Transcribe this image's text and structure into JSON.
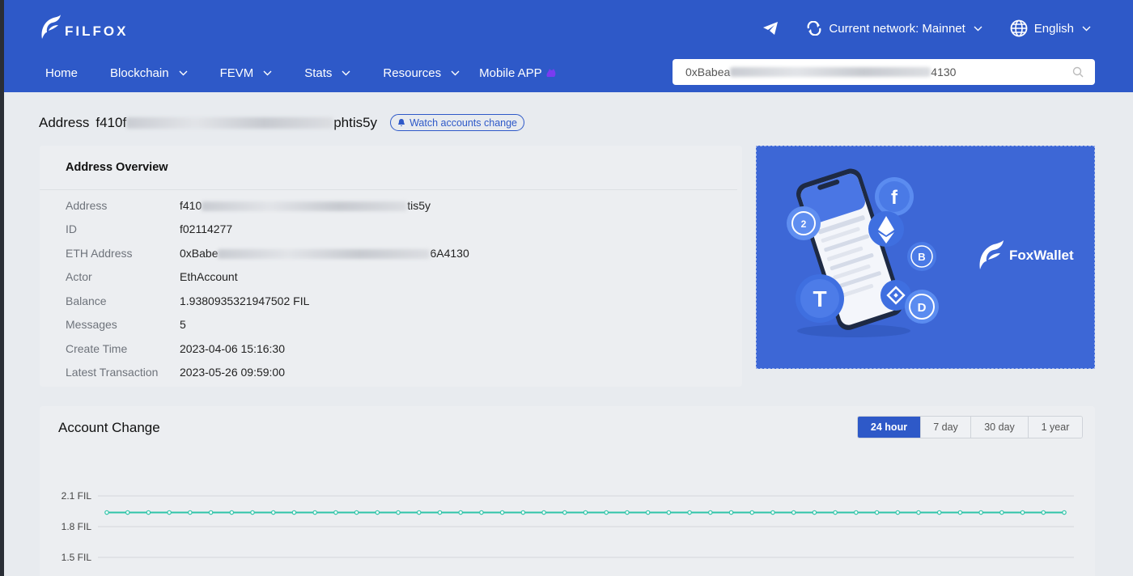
{
  "header": {
    "logo_text": "FILFOX",
    "network_label": "Current network: Mainnet",
    "language": "English",
    "nav": [
      "Home",
      "Blockchain",
      "FEVM",
      "Stats",
      "Resources"
    ],
    "mobile_app": "Mobile APP",
    "search": {
      "prefix": "0xBabea",
      "suffix": "4130"
    },
    "colors": {
      "brand": "#2e59c8"
    }
  },
  "address_title": {
    "label": "Address",
    "prefix": "f410f",
    "suffix": "phtis5y",
    "watch_button": "Watch accounts change"
  },
  "overview": {
    "title": "Address Overview",
    "rows": [
      {
        "key": "Address",
        "prefix": "f410",
        "suffix": "tis5y"
      },
      {
        "key": "ID",
        "value": "f02114277"
      },
      {
        "key": "ETH Address",
        "prefix": "0xBabe",
        "suffix": "6A4130"
      },
      {
        "key": "Actor",
        "value": "EthAccount"
      },
      {
        "key": "Balance",
        "value": "1.9380935321947502 FIL"
      },
      {
        "key": "Messages",
        "value": "5"
      },
      {
        "key": "Create Time",
        "value": "2023-04-06 15:16:30"
      },
      {
        "key": "Latest Transaction",
        "value": "2023-05-26 09:59:00"
      }
    ]
  },
  "banner": {
    "brand": "FoxWallet"
  },
  "account_change": {
    "title": "Account Change",
    "ranges": [
      "24 hour",
      "7 day",
      "30 day",
      "1 year"
    ],
    "active_range": "24 hour"
  },
  "chart_data": {
    "type": "line",
    "y_ticks": [
      "2.1 FIL",
      "1.8 FIL",
      "1.5 FIL"
    ],
    "y_tick_values": [
      2.1,
      1.8,
      1.5
    ],
    "series": [
      {
        "values": [
          1.938,
          1.938,
          1.938,
          1.938,
          1.938,
          1.938,
          1.938,
          1.938,
          1.938,
          1.938,
          1.938,
          1.938,
          1.938,
          1.938,
          1.938,
          1.938,
          1.938,
          1.938,
          1.938,
          1.938,
          1.938,
          1.938,
          1.938,
          1.938,
          1.938,
          1.938,
          1.938,
          1.938,
          1.938,
          1.938,
          1.938,
          1.938,
          1.938,
          1.938,
          1.938,
          1.938,
          1.938,
          1.938,
          1.938,
          1.938,
          1.938,
          1.938,
          1.938,
          1.938,
          1.938,
          1.938,
          1.938
        ],
        "color": "#2ec4a8"
      }
    ],
    "grid": true
  }
}
